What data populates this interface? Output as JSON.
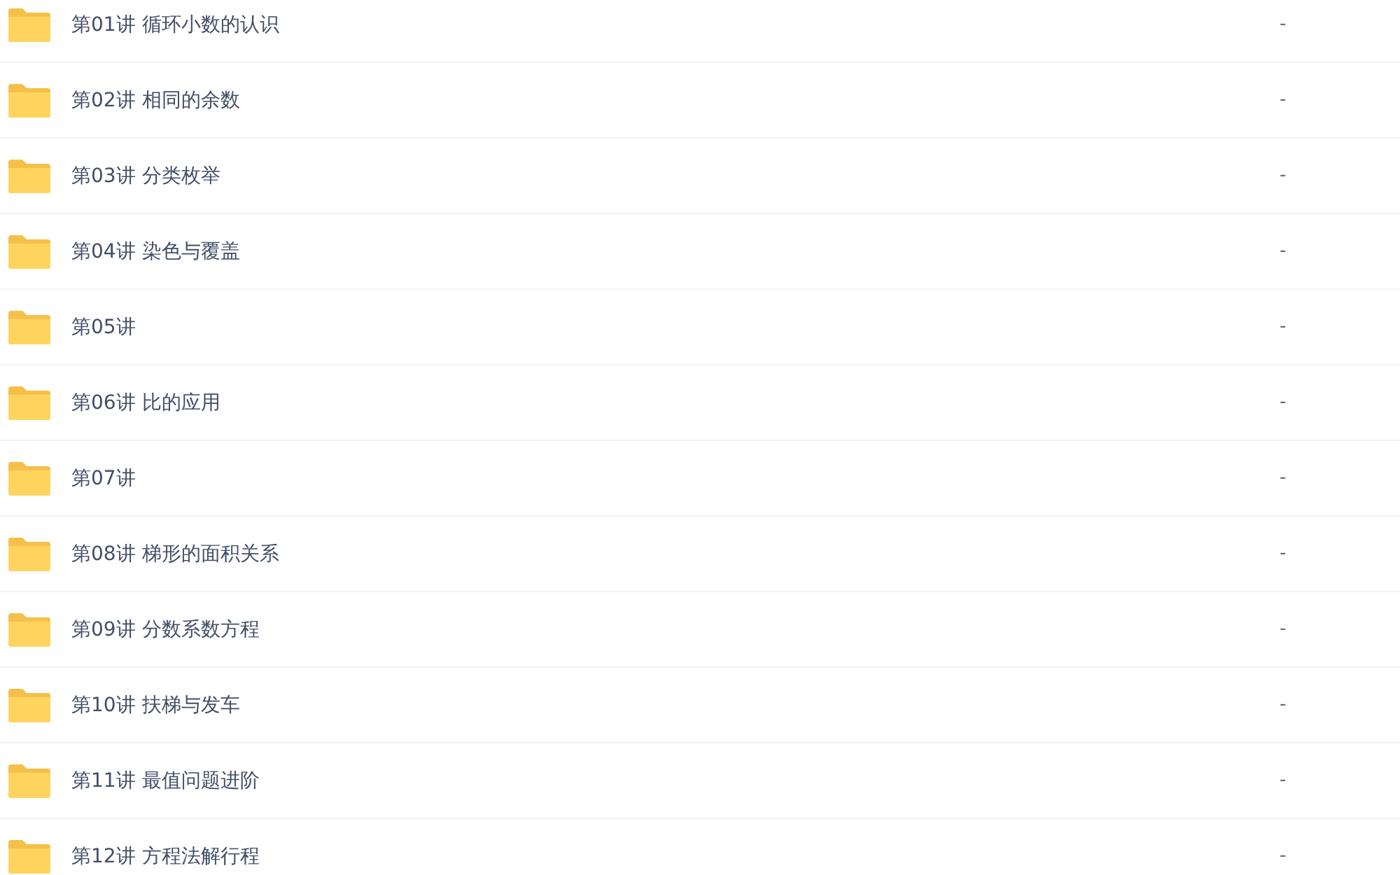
{
  "files": [
    {
      "name": "第01讲 循环小数的认识",
      "size": "-"
    },
    {
      "name": "第02讲 相同的余数",
      "size": "-"
    },
    {
      "name": "第03讲 分类枚举",
      "size": "-"
    },
    {
      "name": "第04讲 染色与覆盖",
      "size": "-"
    },
    {
      "name": "第05讲",
      "size": "-"
    },
    {
      "name": "第06讲 比的应用",
      "size": "-"
    },
    {
      "name": "第07讲",
      "size": "-"
    },
    {
      "name": "第08讲 梯形的面积关系",
      "size": "-"
    },
    {
      "name": "第09讲 分数系数方程",
      "size": "-"
    },
    {
      "name": "第10讲 扶梯与发车",
      "size": "-"
    },
    {
      "name": "第11讲 最值问题进阶",
      "size": "-"
    },
    {
      "name": "第12讲 方程法解行程",
      "size": "-"
    }
  ]
}
